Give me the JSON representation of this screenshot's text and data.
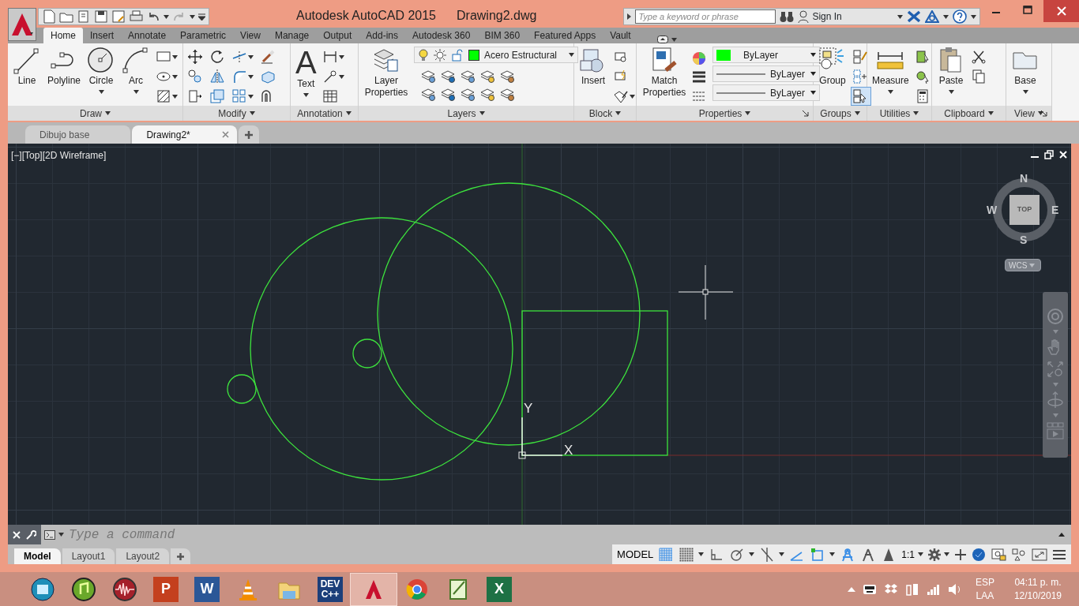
{
  "window": {
    "title": "Autodesk AutoCAD 2015",
    "document": "Drawing2.dwg"
  },
  "search": {
    "placeholder": "Type a keyword or phrase"
  },
  "account": {
    "label": "Sign In"
  },
  "ribbon_tabs": [
    {
      "label": "Home",
      "selected": true
    },
    {
      "label": "Insert",
      "selected": false
    },
    {
      "label": "Annotate",
      "selected": false
    },
    {
      "label": "Parametric",
      "selected": false
    },
    {
      "label": "View",
      "selected": false
    },
    {
      "label": "Manage",
      "selected": false
    },
    {
      "label": "Output",
      "selected": false
    },
    {
      "label": "Add-ins",
      "selected": false
    },
    {
      "label": "Autodesk 360",
      "selected": false
    },
    {
      "label": "BIM 360",
      "selected": false
    },
    {
      "label": "Featured Apps",
      "selected": false
    },
    {
      "label": "Vault",
      "selected": false
    }
  ],
  "panels": [
    {
      "title": "Draw",
      "tools": [
        {
          "label": "Line",
          "menu": false
        },
        {
          "label": "Polyline",
          "menu": false
        },
        {
          "label": "Circle",
          "menu": true
        },
        {
          "label": "Arc",
          "menu": true
        }
      ]
    },
    {
      "title": "Modify"
    },
    {
      "title": "Annotation",
      "tools": [
        {
          "label": "Text",
          "menu": true,
          "glyph": "A"
        }
      ]
    },
    {
      "title": "Layers",
      "tools": [
        {
          "label": "Layer Properties",
          "menu": false
        }
      ],
      "layer": {
        "value": "Acero Estructural",
        "color": "#00ff00"
      }
    },
    {
      "title": "Block",
      "tools": [
        {
          "label": "Insert",
          "menu": false
        }
      ]
    },
    {
      "title": "Properties",
      "launcher": true,
      "tools": [
        {
          "label": "Match Properties",
          "menu": false
        }
      ],
      "dropdowns": [
        {
          "value": "ByLayer",
          "color": "#00ff00"
        },
        {
          "value": "ByLayer"
        },
        {
          "value": "ByLayer"
        }
      ]
    },
    {
      "title": "Groups",
      "tools": [
        {
          "label": "Group",
          "menu": false
        }
      ],
      "toggles": [
        {
          "on": false
        },
        {
          "on": false
        },
        {
          "on": true
        }
      ]
    },
    {
      "title": "Utilities",
      "tools": [
        {
          "label": "Measure",
          "menu": true
        }
      ]
    },
    {
      "title": "Clipboard",
      "tools": [
        {
          "label": "Paste",
          "menu": true
        }
      ]
    },
    {
      "title": "View",
      "launcher": true,
      "tools": [
        {
          "label": "Base",
          "menu": true
        }
      ]
    }
  ],
  "doc_tabs": [
    {
      "label": "Dibujo base",
      "selected": false
    },
    {
      "label": "Drawing2*",
      "selected": true
    }
  ],
  "viewport": {
    "label": "[−][Top][2D Wireframe]",
    "compass": {
      "n": "N",
      "e": "E",
      "s": "S",
      "w": "W"
    },
    "cube_face": "TOP",
    "ucs": "WCS",
    "axis_x": "X",
    "axis_y": "Y"
  },
  "command": {
    "placeholder": "Type a command"
  },
  "layout_tabs": [
    {
      "label": "Model",
      "selected": true
    },
    {
      "label": "Layout1",
      "selected": false
    },
    {
      "label": "Layout2",
      "selected": false
    }
  ],
  "status": {
    "space": "MODEL",
    "scale": "1:1",
    "toggles": [
      {
        "on": true
      },
      {
        "on": false
      },
      {
        "on": false
      },
      {
        "on": false
      },
      {
        "on": false
      },
      {
        "on": true
      },
      {
        "on": true
      },
      {
        "on": true
      },
      {
        "on": false
      },
      {
        "on": false
      }
    ]
  },
  "taskbar": {
    "apps": [
      {
        "selected": false
      },
      {
        "selected": false
      },
      {
        "selected": false
      },
      {
        "selected": false,
        "glyph": "P"
      },
      {
        "selected": false,
        "glyph": "W"
      },
      {
        "selected": false
      },
      {
        "selected": false
      },
      {
        "selected": false,
        "glyph": "DEV",
        "glyph2": "C++"
      },
      {
        "selected": true
      },
      {
        "selected": false
      },
      {
        "selected": false
      },
      {
        "selected": false,
        "glyph": "X"
      }
    ],
    "language": "ESP",
    "layout": "LAA",
    "time": "04:11 p. m.",
    "date": "12/10/2019"
  }
}
